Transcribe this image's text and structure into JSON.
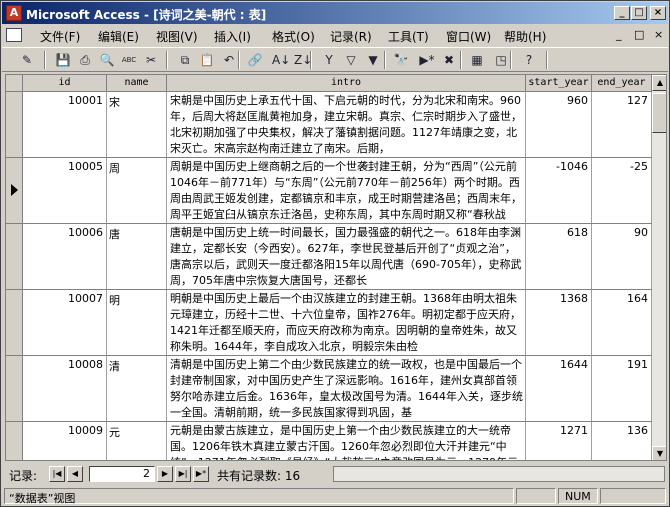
{
  "window": {
    "title": "Microsoft Access - [诗词之美-朝代 : 表]",
    "logo_letter": "A",
    "caption_buttons": [
      "_",
      "□",
      "×"
    ]
  },
  "menu": {
    "items": [
      "文件(F)",
      "编辑(E)",
      "视图(V)",
      "插入(I)",
      "格式(O)",
      "记录(R)",
      "工具(T)",
      "窗口(W)",
      "帮助(H)"
    ],
    "doc_buttons": [
      "_",
      "□",
      "×"
    ]
  },
  "toolbar": {
    "icons": [
      "design-view",
      "save",
      "print",
      "print-preview",
      "spelling",
      "cut",
      "copy",
      "paste",
      "undo",
      "hyperlink",
      "sort-ascending",
      "sort-descending",
      "filter-by-selection",
      "filter-by-form",
      "apply-filter",
      "find",
      "new-record",
      "delete-record",
      "database-window",
      "new-object",
      "help"
    ],
    "glyphs": [
      "✎",
      "💾",
      "⎙",
      "🔍",
      "ABC",
      "✂",
      "⧉",
      "📋",
      "↶",
      "🔗",
      "A↓",
      "Z↓",
      "Y",
      "▽",
      "▼",
      "🔭",
      "▶*",
      "✖",
      "▦",
      "◳",
      "?"
    ]
  },
  "table": {
    "columns": [
      "id",
      "name",
      "intro",
      "start_year",
      "end_year"
    ],
    "current_row_index": 1,
    "rows": [
      {
        "id": "10001",
        "name": "宋",
        "intro": "宋朝是中国历史上承五代十国、下启元朝的时代，分为北宋和南宋。960年，后周大将赵匡胤黄袍加身，建立宋朝。真宗、仁宗时期步入了盛世，北宋初期加强了中央集权，解决了藩镇割据问题。1127年靖康之变，北宋灭亡。宋高宗赵构南迁建立了南宋。后期，",
        "start_year": "960",
        "end_year": "127"
      },
      {
        "id": "10005",
        "name": "周",
        "intro": "周朝是中国历史上继商朝之后的一个世袭封建王朝，分为“西周”（公元前1046年－前771年）与“东周”（公元前770年－前256年）两个时期。西周由周武王姬发创建，定都镐京和丰京，成王时期营建洛邑；西周末年，周平王姬宜臼从镐京东迁洛邑，史称东周，其中东周时期又称“春秋战国”，分为“春秋”及“战国”两",
        "start_year": "-1046",
        "end_year": "-25"
      },
      {
        "id": "10006",
        "name": "唐",
        "intro": "唐朝是中国历史上统一时间最长，国力最强盛的朝代之一。618年由李渊建立，定都长安（今西安）。627年，李世民登基后开创了“贞观之治”，唐高宗以后，武则天一度迁都洛阳15年以周代唐（690-705年），史称武周，705年唐中宗恢复大唐国号，还都长",
        "start_year": "618",
        "end_year": "90"
      },
      {
        "id": "10007",
        "name": "明",
        "intro": "明朝是中国历史上最后一个由汉族建立的封建王朝。1368年由明太祖朱元璋建立，历经十二世、十六位皇帝，国祚276年。明初定都于应天府，1421年迁都至顺天府，而应天府改称为南京。因明朝的皇帝姓朱，故又称朱明。1644年，李自成攻入北京，明毅宗朱由检",
        "start_year": "1368",
        "end_year": "164"
      },
      {
        "id": "10008",
        "name": "清",
        "intro": "清朝是中国历史上第二个由少数民族建立的统一政权，也是中国最后一个封建帝制国家，对中国历史产生了深远影响。1616年，建州女真部首领努尔哈赤建立后金。1636年，皇太极改国号为清。1644年入关，逐步统一全国。清朝前期，统一多民族国家得到巩固，基",
        "start_year": "1644",
        "end_year": "191"
      },
      {
        "id": "10009",
        "name": "元",
        "intro": "元朝是由蒙古族建立，是中国历史上第一个由少数民族建立的大一统帝国。1206年铁木真建立蒙古汗国。1260年忽必烈即位大汗并建元“中统”，1271年忽必烈取《易经》“大哉乾元”之意改国号为元，1279年元军灭南宋，统一全国。元朝的疆域空前广阔，北至北",
        "start_year": "1271",
        "end_year": "136"
      }
    ]
  },
  "navigation": {
    "label": "记录:",
    "current_record": "2",
    "total_label": "共有记录数: 16",
    "buttons": [
      "|◀",
      "◀",
      "▶",
      "▶|",
      "▶*"
    ]
  },
  "status": {
    "view": "“数据表”视图",
    "num": "NUM"
  }
}
